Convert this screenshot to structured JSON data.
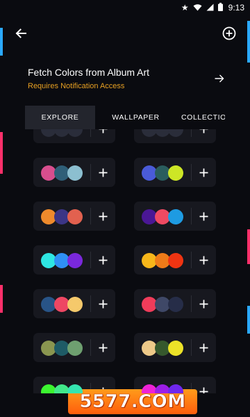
{
  "status_bar": {
    "time": "9:13",
    "icons": [
      "star-icon",
      "wifi-icon",
      "signal-icon",
      "battery-icon"
    ]
  },
  "app_bar": {
    "back_icon": "back-arrow-icon",
    "add_icon": "add-circle-icon"
  },
  "fetch": {
    "title": "Fetch Colors from Album Art",
    "subtitle": "Requires Notification Access",
    "subtitle_color": "#e7a022",
    "icon": "arrow-right-icon"
  },
  "tabs": [
    {
      "label": "EXPLORE",
      "active": true
    },
    {
      "label": "WALLPAPER",
      "active": false
    },
    {
      "label": "COLLECTIONS",
      "active": false
    }
  ],
  "palettes": [
    {
      "colors": [
        "#2a2d3a",
        "#2a2d3a",
        "#2a2d3a"
      ],
      "partial": true
    },
    {
      "colors": [
        "#2a2d3a",
        "#2a2d3a",
        "#2a2d3a"
      ],
      "partial": true
    },
    {
      "colors": [
        "#d84e8e",
        "#2f5f78",
        "#8cbfd0"
      ]
    },
    {
      "colors": [
        "#4a5bd8",
        "#2a5d5e",
        "#cde626"
      ]
    },
    {
      "colors": [
        "#ee8a2c",
        "#3b3586",
        "#e2614f"
      ]
    },
    {
      "colors": [
        "#4a1795",
        "#ef4a62",
        "#1e9be2"
      ]
    },
    {
      "colors": [
        "#2ee6e2",
        "#2f90f4",
        "#7a28dc"
      ]
    },
    {
      "colors": [
        "#f6b61a",
        "#ee7b19",
        "#ef3412"
      ]
    },
    {
      "colors": [
        "#285487",
        "#ee4763",
        "#f5c96b"
      ]
    },
    {
      "colors": [
        "#ef3c5a",
        "#3f4867",
        "#262d48"
      ]
    },
    {
      "colors": [
        "#8a9650",
        "#1e5b66",
        "#6ea070"
      ]
    },
    {
      "colors": [
        "#edc989",
        "#36582d",
        "#ece228"
      ]
    },
    {
      "colors": [
        "#3cf530",
        "#42e88a",
        "#35e5b1"
      ]
    },
    {
      "colors": [
        "#ee22d6",
        "#9c1ee6",
        "#6f27ee"
      ]
    }
  ],
  "watermark": {
    "text": "5577.COM"
  }
}
